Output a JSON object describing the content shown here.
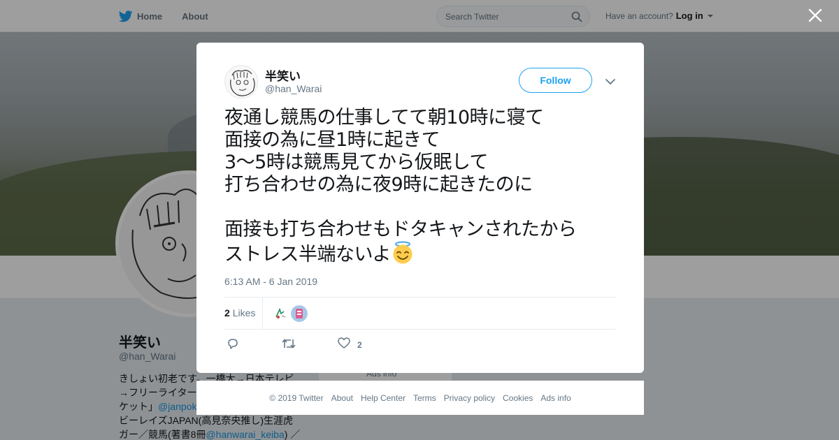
{
  "nav": {
    "home_label": "Home",
    "about_label": "About",
    "search_placeholder": "Search Twitter",
    "account_prompt": "Have an account?",
    "login_label": "Log in",
    "brand_color": "#1da1f2"
  },
  "profile": {
    "name": "半笑い",
    "handle": "@han_Warai",
    "bio_line1": "きしょい初老です。一橋大→日本テレビ",
    "bio_line2": "→フリーライター",
    "bio_line3_a": "ケット」",
    "bio_line3_link": "@janpok",
    "bio_line4": "ビーレイズJAPAN(高見奈央推し)生涯虎",
    "bio_line5_a": "ガー／競馬(著書8冊",
    "bio_line5_link": "@hanwarai_keiba",
    "bio_line5_b": ") ／",
    "ads_info": "Ads info"
  },
  "tweet": {
    "author_name": "半笑い",
    "author_handle": "@han_Warai",
    "follow_label": "Follow",
    "text": "夜通し競馬の仕事してて朝10時に寝て\n面接の為に昼1時に起きて\n3〜5時は競馬見てから仮眠して\n打ち合わせの為に夜9時に起きたのに\n\n面接も打ち合わせもドタキャンされたから\nストレス半端ないよ",
    "emoji": "smiling-face-with-halo",
    "timestamp": "6:13 AM - 6 Jan 2019",
    "likes_count": "2",
    "likes_label": "Likes",
    "like_action_count": "2"
  },
  "footer": {
    "items": [
      "© 2019 Twitter",
      "About",
      "Help Center",
      "Terms",
      "Privacy policy",
      "Cookies",
      "Ads info"
    ]
  }
}
